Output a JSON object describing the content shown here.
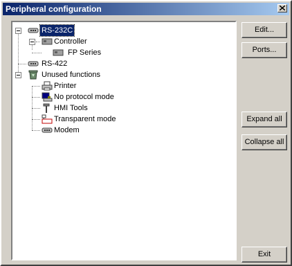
{
  "window": {
    "title": "Peripheral configuration"
  },
  "tree": {
    "rs232c": "RS-232C",
    "controller": "Controller",
    "fp_series": "FP Series",
    "rs422": "RS-422",
    "unused": "Unused functions",
    "printer": "Printer",
    "no_protocol": "No protocol mode",
    "hmi_tools": "HMI Tools",
    "transparent": "Transparent mode",
    "modem": "Modem"
  },
  "buttons": {
    "edit": "Edit...",
    "ports": "Ports...",
    "expand_all": "Expand all",
    "collapse_all": "Collapse all",
    "exit": "Exit"
  },
  "icons": {
    "connector": "serial-port-icon",
    "controller": "controller-icon",
    "unused": "recycle-bin-icon",
    "printer": "printer-icon",
    "no_protocol": "terminal-icon",
    "hmi": "tools-icon",
    "transparent": "network-icon",
    "modem": "modem-icon"
  }
}
